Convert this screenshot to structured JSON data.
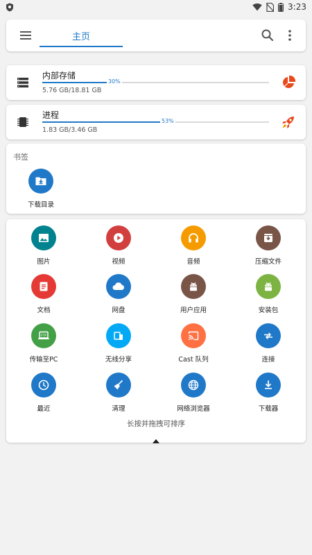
{
  "status_bar": {
    "time": "3:23"
  },
  "app_bar": {
    "tab_label": "主页"
  },
  "storage_items": [
    {
      "name": "内部存储",
      "size": "5.76 GB/18.81 GB",
      "percent": "30%",
      "percent_value": 0.3,
      "icon": "storage-list-icon",
      "action_icon": "pie-chart-icon",
      "action_color": "#e8491d"
    },
    {
      "name": "进程",
      "size": "1.83 GB/3.46 GB",
      "percent": "53%",
      "percent_value": 0.53,
      "icon": "chip-icon",
      "action_icon": "rocket-icon",
      "action_color": "#e8491d"
    }
  ],
  "bookmarks": {
    "title": "书签",
    "items": [
      {
        "label": "下载目录",
        "icon": "download-folder-icon",
        "color": "#1f78c8"
      }
    ]
  },
  "grid_items": [
    {
      "label": "图片",
      "icon": "image-icon",
      "color": "#00838f"
    },
    {
      "label": "视频",
      "icon": "play-icon",
      "color": "#d23f3f"
    },
    {
      "label": "音频",
      "icon": "headphones-icon",
      "color": "#f59b00"
    },
    {
      "label": "压缩文件",
      "icon": "archive-icon",
      "color": "#795548"
    },
    {
      "label": "文档",
      "icon": "document-icon",
      "color": "#e53935"
    },
    {
      "label": "网盘",
      "icon": "cloud-icon",
      "color": "#1f78c8"
    },
    {
      "label": "用户应用",
      "icon": "android-icon",
      "color": "#795548"
    },
    {
      "label": "安装包",
      "icon": "android-icon",
      "color": "#7cb342"
    },
    {
      "label": "传输至PC",
      "icon": "ftp-laptop-icon",
      "color": "#43a047"
    },
    {
      "label": "无线分享",
      "icon": "devices-icon",
      "color": "#03a9f4"
    },
    {
      "label": "Cast 队列",
      "icon": "cast-icon",
      "color": "#ff7043"
    },
    {
      "label": "连接",
      "icon": "swap-arrows-icon",
      "color": "#1f78c8"
    },
    {
      "label": "最近",
      "icon": "clock-icon",
      "color": "#1f78c8"
    },
    {
      "label": "清理",
      "icon": "broom-icon",
      "color": "#1f78c8"
    },
    {
      "label": "网络浏览器",
      "icon": "globe-icon",
      "color": "#1f78c8"
    },
    {
      "label": "下载器",
      "icon": "download-icon",
      "color": "#1f78c8"
    }
  ],
  "grid_hint": "长按并拖拽可排序"
}
